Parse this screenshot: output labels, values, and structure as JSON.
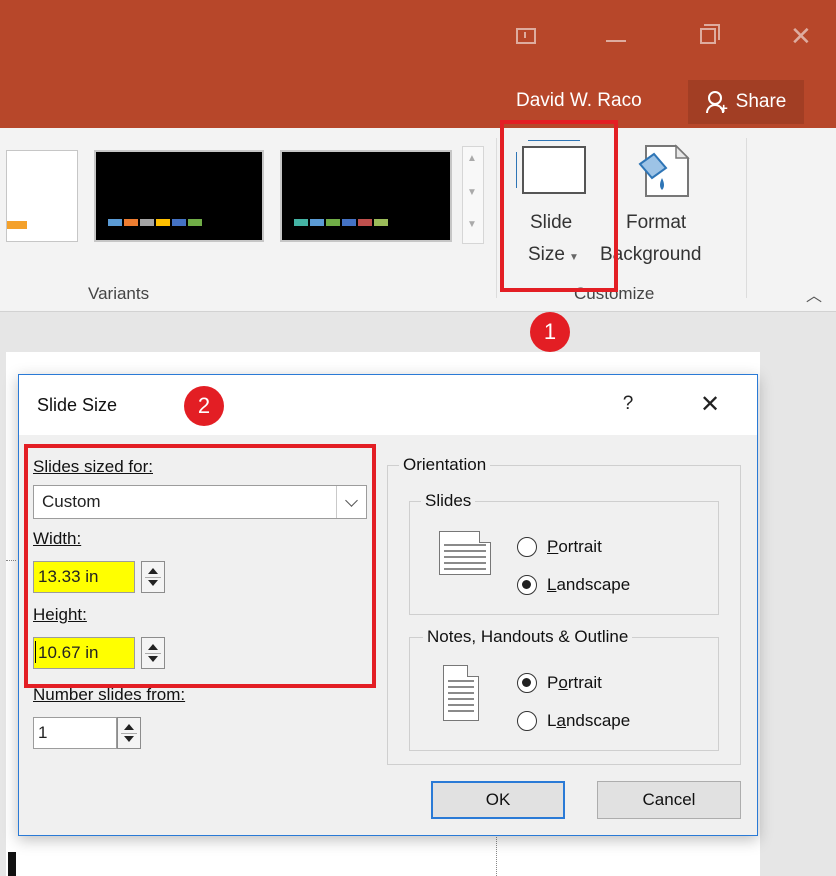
{
  "window": {
    "user_name": "David W. Raco",
    "share_label": "Share"
  },
  "ribbon": {
    "variants_label": "Variants",
    "slide_size_line1": "Slide",
    "slide_size_line2": "Size",
    "format_bg_line1": "Format",
    "format_bg_line2": "Background",
    "customize_label": "Customize",
    "swatch_colors_v1": [
      "#5b9bd5",
      "#ed7d31",
      "#a5a5a5",
      "#ffc000",
      "#4472c4",
      "#70ad47"
    ],
    "swatch_colors_v2": [
      "#44b3a4",
      "#5b9bd5",
      "#70ad47",
      "#4472c4",
      "#c0504d",
      "#9bbb59"
    ]
  },
  "callouts": {
    "one": "1",
    "two": "2",
    "color": "#e31e24"
  },
  "dialog": {
    "title": "Slide Size",
    "help": "?",
    "close": "✕",
    "slides_sized_for_label": "Slides sized for:",
    "slides_sized_for_value": "Custom",
    "width_label": "Width:",
    "width_value": "13.33 in",
    "height_label": "Height:",
    "height_value": "10.67 in",
    "number_slides_label": "Number slides from:",
    "number_slides_value": "1",
    "orientation_label": "Orientation",
    "slides_group_label": "Slides",
    "slides_portrait": "Portrait",
    "slides_landscape": "Landscape",
    "slides_selected": "Landscape",
    "notes_group_label": "Notes, Handouts & Outline",
    "notes_portrait": "Portrait",
    "notes_landscape": "Landscape",
    "notes_selected": "Portrait",
    "ok_label": "OK",
    "cancel_label": "Cancel"
  }
}
